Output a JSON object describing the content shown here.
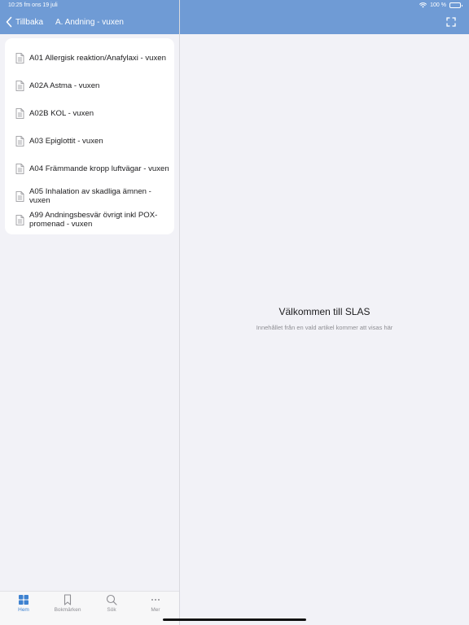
{
  "status": {
    "time": "10:25 fm   ons 19 juli",
    "battery": "100 %"
  },
  "nav": {
    "back_label": "Tillbaka",
    "title": "A. Andning - vuxen"
  },
  "list": {
    "items": [
      {
        "label": "A01 Allergisk reaktion/Anafylaxi - vuxen"
      },
      {
        "label": "A02A Astma - vuxen"
      },
      {
        "label": "A02B KOL - vuxen"
      },
      {
        "label": "A03 Epiglottit - vuxen"
      },
      {
        "label": "A04 Främmande kropp luftvägar - vuxen"
      },
      {
        "label": "A05 Inhalation av skadliga ämnen - vuxen"
      },
      {
        "label": "A99 Andningsbesvär övrigt inkl POX-promenad - vuxen"
      }
    ]
  },
  "detail": {
    "title": "Välkommen till SLAS",
    "subtitle": "Innehållet från en vald artikel kommer att visas här"
  },
  "tabbar": {
    "tabs": [
      {
        "label": "Hem",
        "icon": "grid-icon",
        "active": true
      },
      {
        "label": "Bokmärken",
        "icon": "bookmark-icon",
        "active": false
      },
      {
        "label": "Sök",
        "icon": "search-icon",
        "active": false
      },
      {
        "label": "Mer",
        "icon": "more-icon",
        "active": false
      }
    ]
  },
  "colors": {
    "accent": "#6f9bd5",
    "active_tab": "#3e82d0",
    "background": "#f2f2f7"
  }
}
